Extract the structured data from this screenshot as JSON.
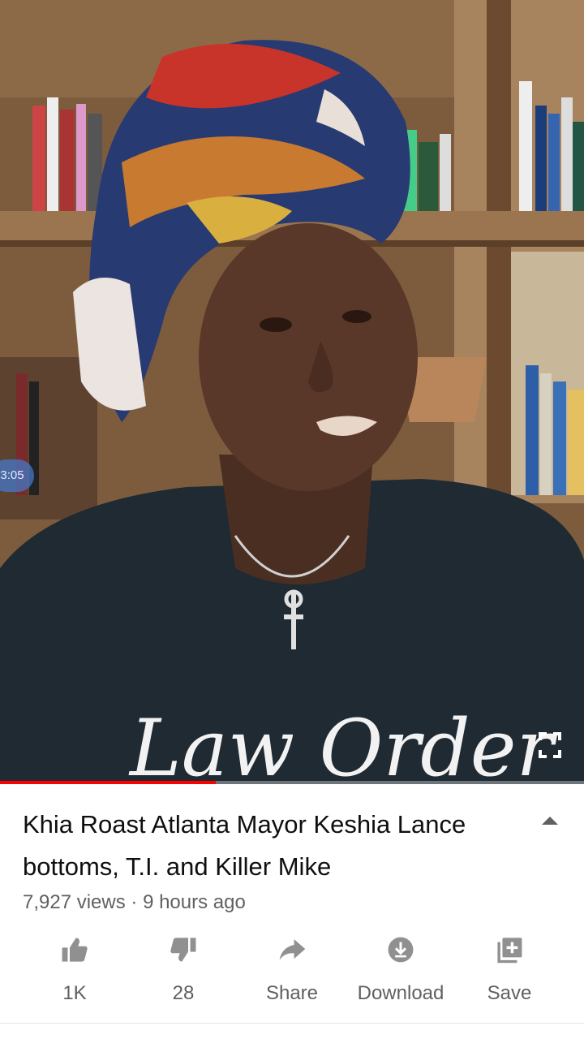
{
  "video": {
    "timestamp_badge": "3:05",
    "shirt_text": "Law Order",
    "progress_fraction": 0.37
  },
  "details": {
    "title": "Khia Roast Atlanta Mayor Keshia Lance bottoms, T.I. and Killer Mike",
    "meta": "7,927 views · 9 hours ago"
  },
  "actions": {
    "like": {
      "label": "1K",
      "icon": "thumbs-up-icon"
    },
    "dislike": {
      "label": "28",
      "icon": "thumbs-down-icon"
    },
    "share": {
      "label": "Share",
      "icon": "share-icon"
    },
    "download": {
      "label": "Download",
      "icon": "download-icon"
    },
    "save": {
      "label": "Save",
      "icon": "save-playlist-icon"
    }
  },
  "colors": {
    "progress": "#ff0000",
    "text_primary": "#0f0f0f",
    "text_secondary": "#606060",
    "icon": "#909090"
  }
}
